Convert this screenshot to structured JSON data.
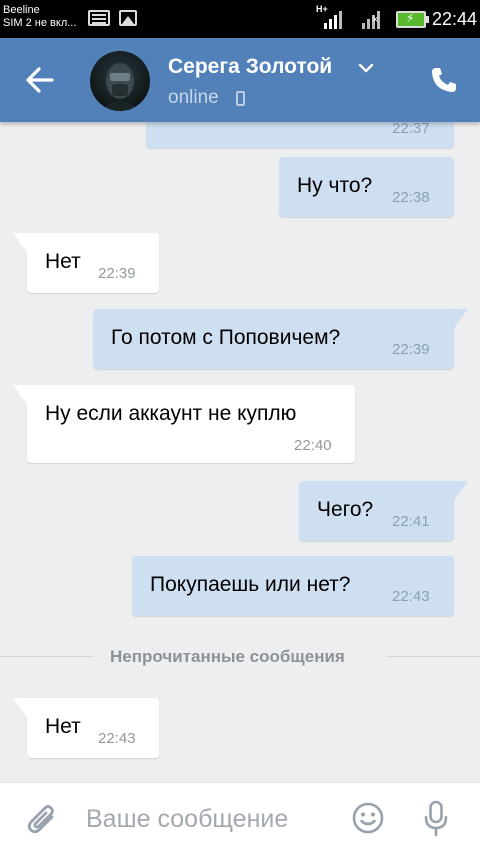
{
  "status_bar": {
    "carrier_line1": "Beeline",
    "carrier_line2": "SIM 2 не вкл...",
    "network_type": "H+",
    "sim2_no_signal": "×",
    "battery_state": "charging",
    "time": "22:44"
  },
  "header": {
    "back_icon": "arrow-left-icon",
    "contact_name": "Серега Золотой",
    "status": "online",
    "status_device_icon": "mobile-phone-icon",
    "call_icon": "phone-icon",
    "colors": {
      "header_bg": "#5181b8",
      "outgoing_bubble": "#cfdff2",
      "incoming_bubble": "#ffffff",
      "chat_bg": "#edeef0"
    }
  },
  "messages": [
    {
      "direction": "out",
      "text": "",
      "time": "22:37"
    },
    {
      "direction": "out",
      "text": "Ну что?",
      "time": "22:38"
    },
    {
      "direction": "in",
      "text": "Нет",
      "time": "22:39"
    },
    {
      "direction": "out",
      "text": "Го потом с Поповичем?",
      "time": "22:39"
    },
    {
      "direction": "in",
      "text": "Ну если аккаунт не куплю",
      "time": "22:40"
    },
    {
      "direction": "out",
      "text": "Чего?",
      "time": "22:41"
    },
    {
      "direction": "out",
      "text": "Покупаешь или нет?",
      "time": "22:43"
    },
    {
      "direction": "in",
      "text": "Нет",
      "time": "22:43"
    }
  ],
  "unread_divider": "Непрочитанные сообщения",
  "composer": {
    "placeholder": "Ваше сообщение",
    "attach_icon": "paperclip-icon",
    "emoji_icon": "smiley-icon",
    "mic_icon": "microphone-icon"
  }
}
